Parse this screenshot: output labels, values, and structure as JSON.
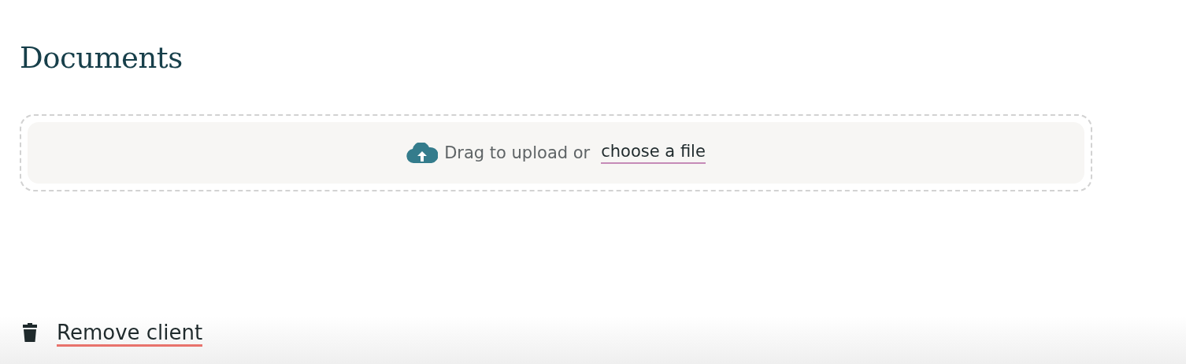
{
  "heading": "Documents",
  "upload": {
    "prompt": "Drag to upload or",
    "link": "choose a file"
  },
  "footer": {
    "action": "Remove client"
  }
}
